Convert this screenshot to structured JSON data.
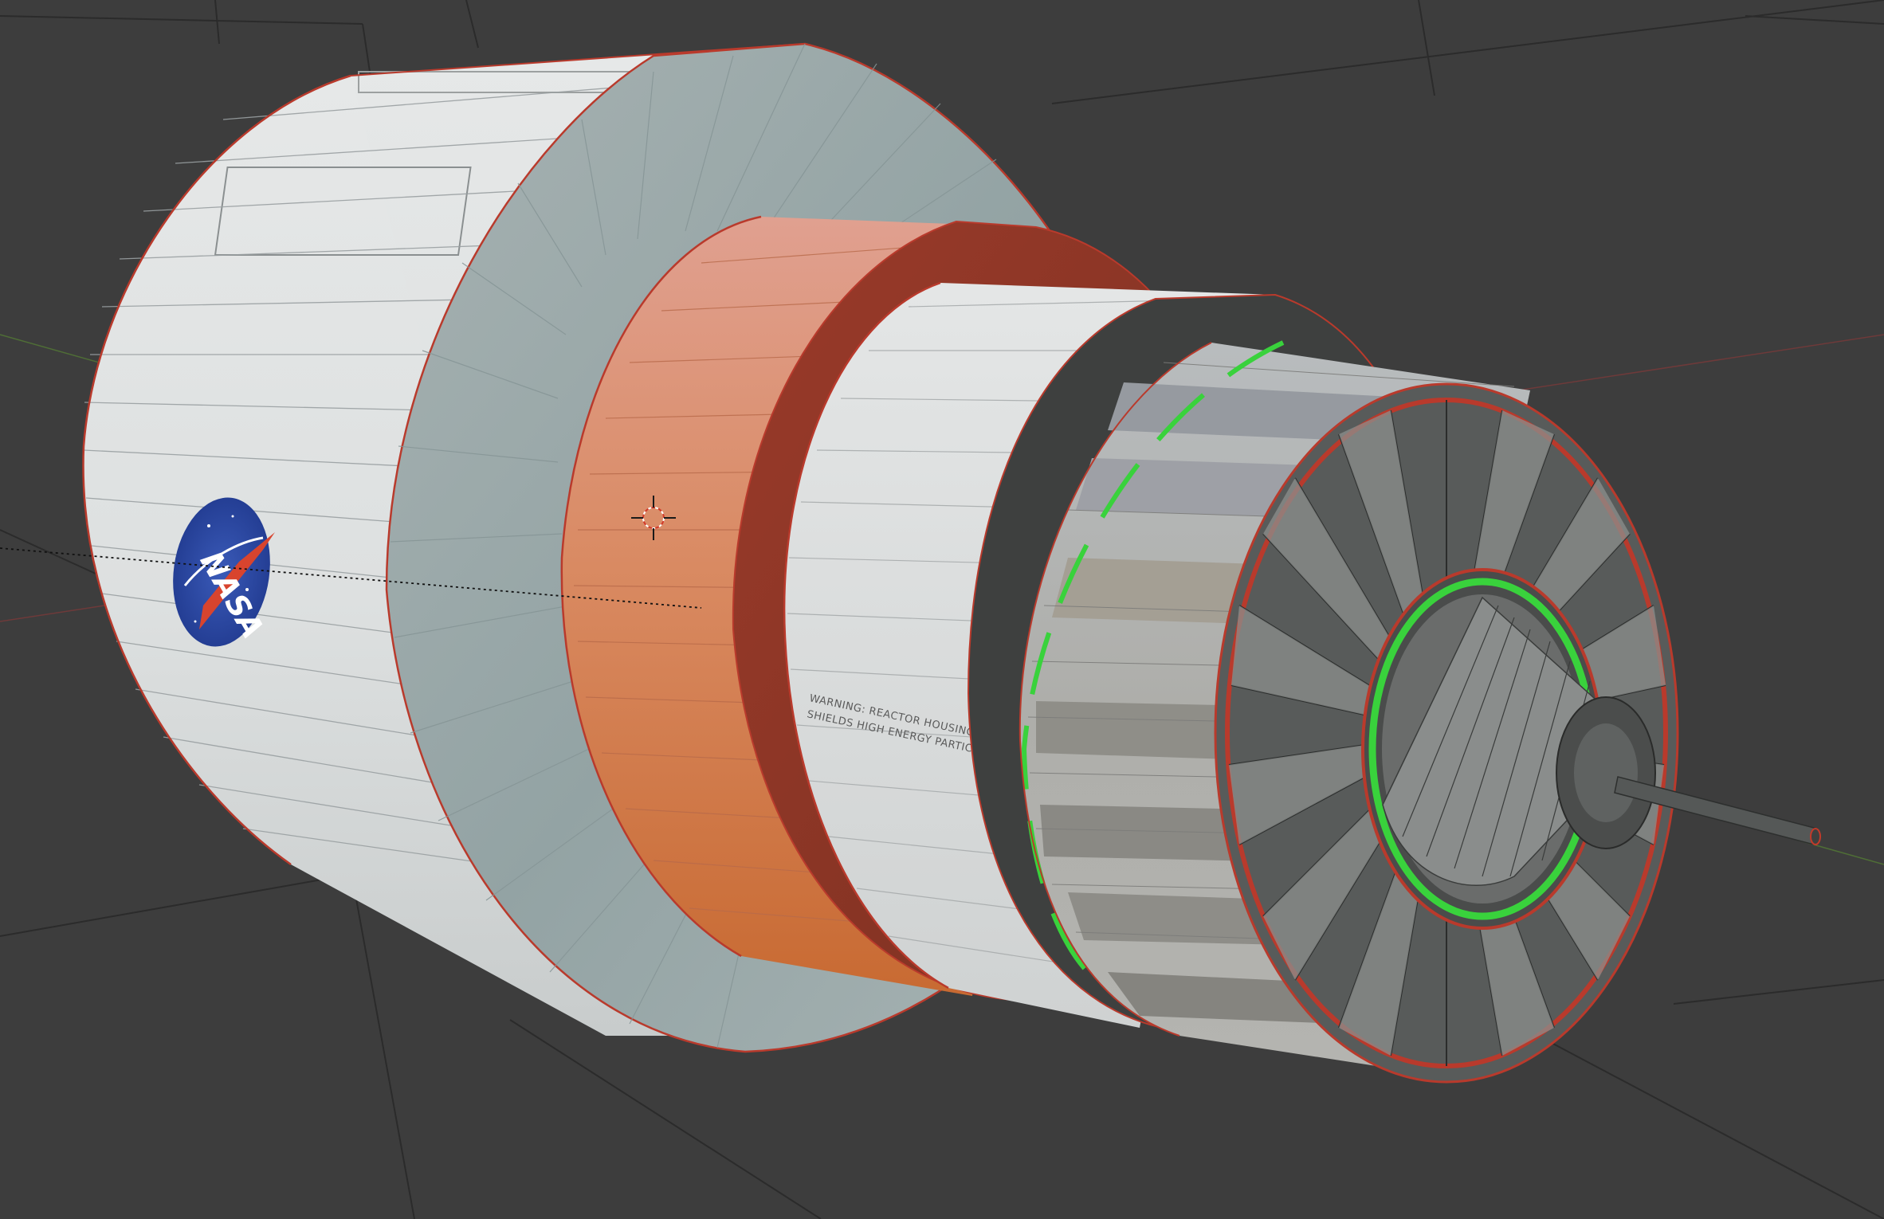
{
  "viewport": {
    "background": "#3d3d3d",
    "mode": "3D viewport - edit mode"
  },
  "decals": {
    "logo_text": "NASA",
    "warning_line1": "WARNING: REACTOR HOUSING",
    "warning_line2": "SHIELDS HIGH ENERGY PARTICLES"
  },
  "colors": {
    "hull_white": "#d8dcdc",
    "hull_blue_gray": "#9aa8a8",
    "orange_band": "#d8824a",
    "selection_edge": "#c23a2a",
    "active_edge_green": "#39d23c",
    "grid_line": "#2a2a2a",
    "x_axis": "#7a3a3a",
    "y_axis": "#5a7a3a"
  },
  "icons": {
    "cursor": "3d-cursor-icon"
  }
}
